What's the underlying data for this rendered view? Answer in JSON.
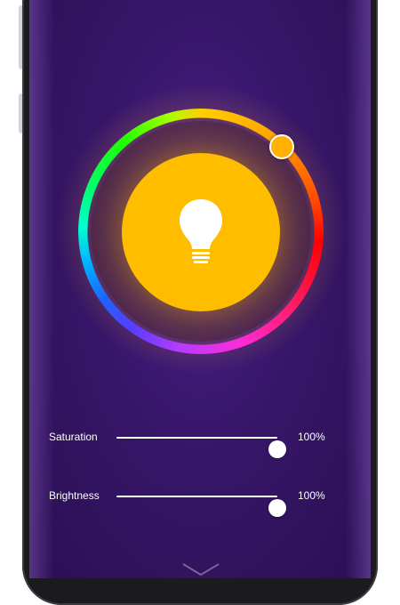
{
  "colors": {
    "background": "#2f1160",
    "bulb_fill": "#ffbd00",
    "hue_thumb": "#ffb100",
    "text": "#ffffff"
  },
  "light": {
    "icon": "lightbulb-icon",
    "power_state": "on"
  },
  "color_wheel": {
    "selected_color": "#ffb100"
  },
  "saturation": {
    "label": "Saturation",
    "value": 100,
    "value_text": "100%"
  },
  "brightness": {
    "label": "Brightness",
    "value": 100,
    "value_text": "100%"
  },
  "footer": {
    "icon": "chevron-down-icon"
  }
}
